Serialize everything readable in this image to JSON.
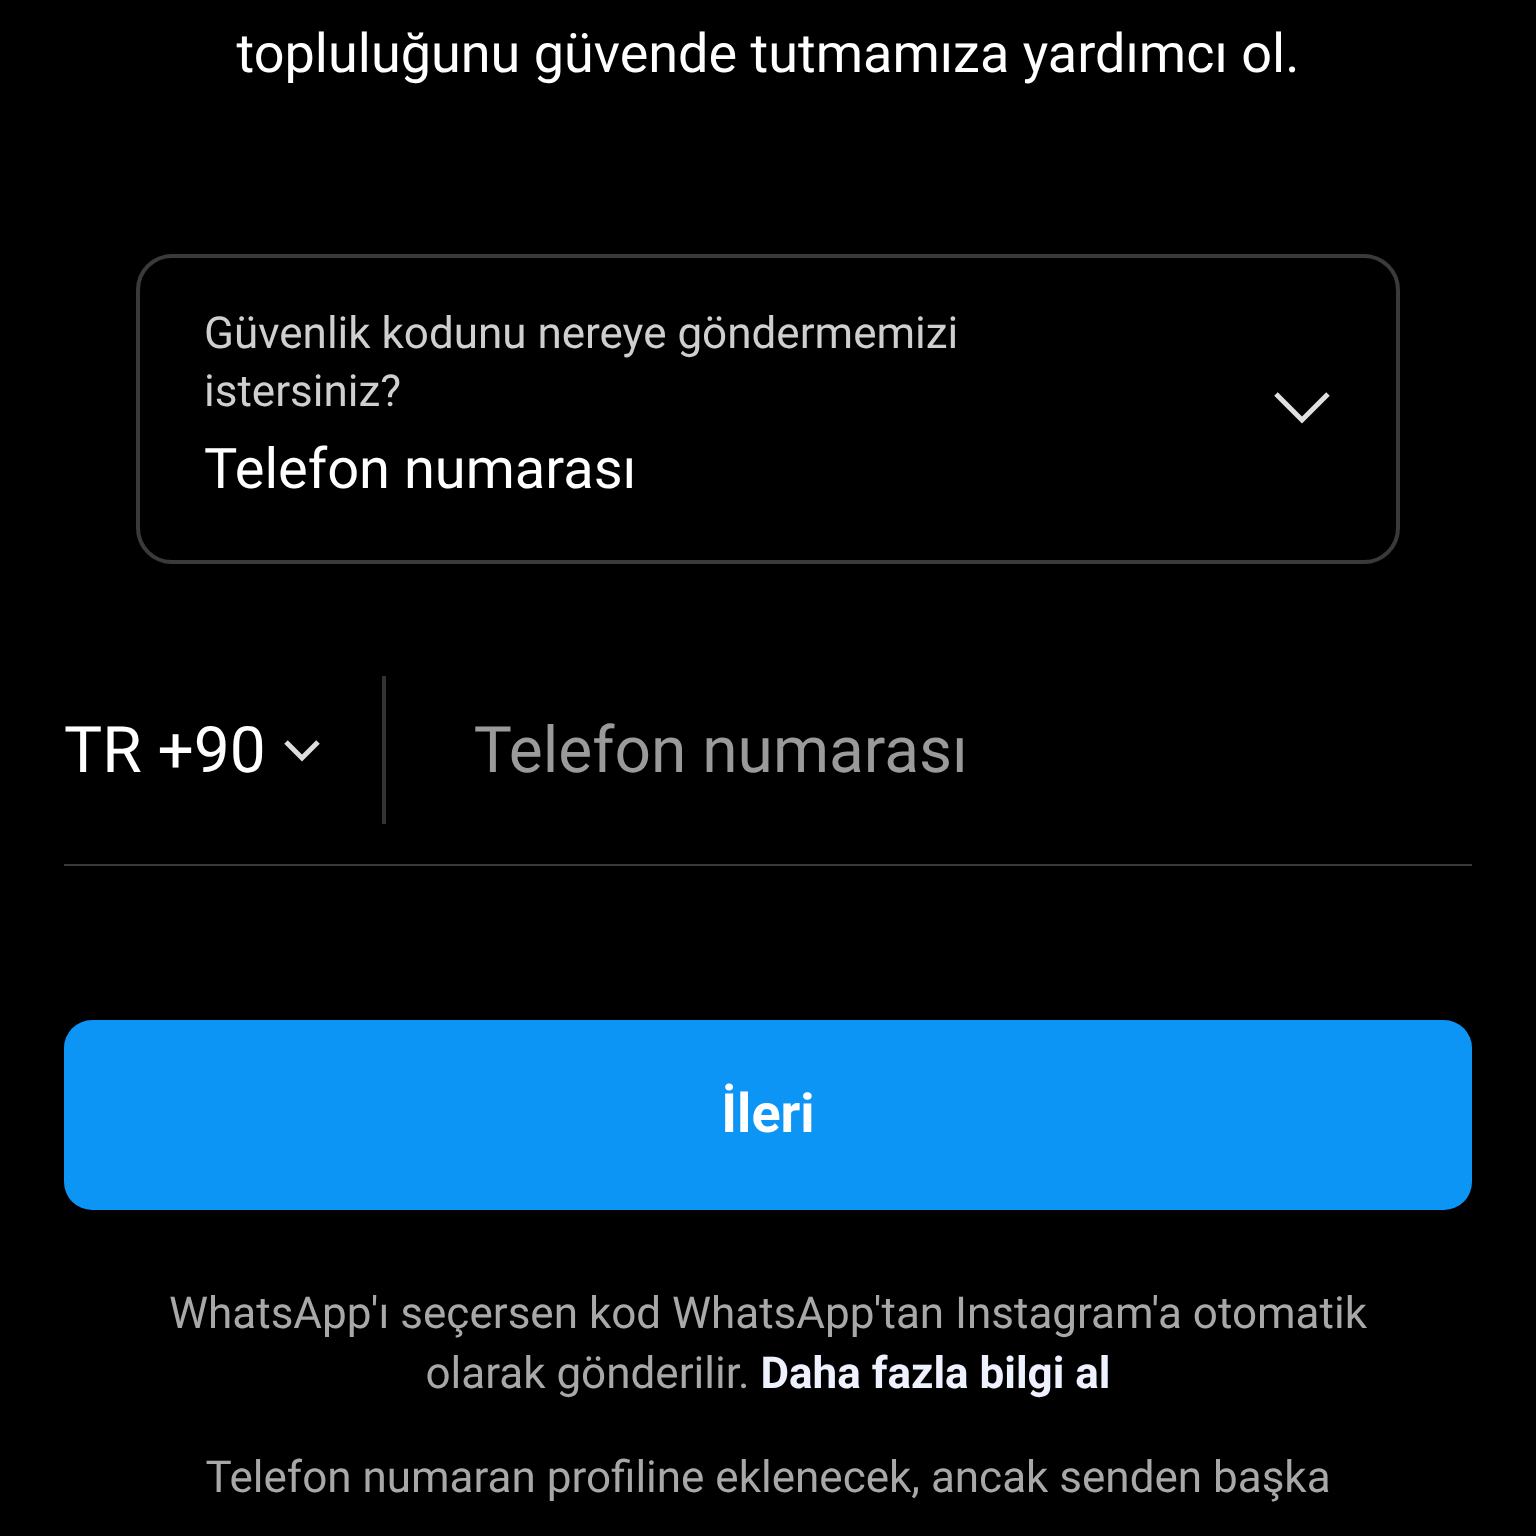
{
  "intro": {
    "text": "topluluğunu güvende tutmamıza yardımcı ol."
  },
  "destination": {
    "label": "Güvenlik kodunu nereye göndermemizi istersiniz?",
    "value": "Telefon numarası"
  },
  "phone": {
    "country": "TR +90",
    "placeholder": "Telefon numarası"
  },
  "next_button": {
    "label": "İleri"
  },
  "whatsapp_note": {
    "text": "WhatsApp'ı seçersen kod WhatsApp'tan Instagram'a otomatik olarak gönderilir.",
    "link": "Daha fazla bilgi al"
  },
  "privacy_note": {
    "text": "Telefon numaran profiline eklenecek, ancak senden başka"
  }
}
